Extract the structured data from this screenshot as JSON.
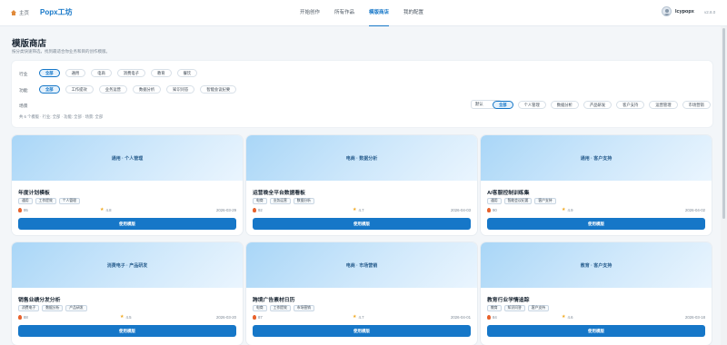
{
  "header": {
    "home_label": "主页",
    "brand": "Popx工坊",
    "nav": [
      "开始创作",
      "所有作品",
      "模版商店",
      "我的配置"
    ],
    "active_nav": "模版商店",
    "username": "lcypopx",
    "version": "v2.8.0"
  },
  "page": {
    "title": "模版商店",
    "subtitle": "按分类快速筛选，找到最适合你业务和目的创作模版。"
  },
  "filters": {
    "industry": {
      "label": "行业",
      "options": [
        "全部",
        "通用",
        "电商",
        "消费电子",
        "教育",
        "餐饮"
      ]
    },
    "function": {
      "label": "功能",
      "options": [
        "全部",
        "工作提效",
        "业务运营",
        "数据分析",
        "知识问答",
        "智能会议纪要"
      ]
    },
    "scene": {
      "label": "场景",
      "options": [
        "全部",
        "个人管理",
        "数据分析",
        "产品研发",
        "客户支持",
        "运营管理",
        "市场营销"
      ]
    },
    "sort": "默认",
    "summary": "共 6 个模版 · 行业: 全部 · 功能: 全部 · 场景: 全部"
  },
  "cards": [
    {
      "banner": "通用 · 个人管理",
      "title": "年度计划模板",
      "tags": [
        "通用",
        "工作提效",
        "个人管理"
      ],
      "uses": "95",
      "rating": "4.8",
      "date": "2026-03-29",
      "button": "使用模版"
    },
    {
      "banner": "电商 · 数据分析",
      "title": "运营晚全平台数据看板",
      "tags": [
        "电商",
        "业务运营",
        "数据分析"
      ],
      "uses": "92",
      "rating": "4.7",
      "date": "2026-04-03",
      "button": "使用模版"
    },
    {
      "banner": "通用 · 客户支持",
      "title": "AI客服控制训练集",
      "tags": [
        "通用",
        "智能会议纪要",
        "客户支持"
      ],
      "uses": "90",
      "rating": "4.9",
      "date": "2026-04-02",
      "button": "使用模版"
    },
    {
      "banner": "消费电子 · 产品研发",
      "title": "销售业绩分发分析",
      "tags": [
        "消费电子",
        "数据分析",
        "产品研发"
      ],
      "uses": "88",
      "rating": "4.5",
      "date": "2026-03-20",
      "button": "使用模版"
    },
    {
      "banner": "电商 · 市场营销",
      "title": "跨境广告素材日历",
      "tags": [
        "电商",
        "工作提效",
        "市场营销"
      ],
      "uses": "87",
      "rating": "4.7",
      "date": "2026-04-01",
      "button": "使用模版"
    },
    {
      "banner": "教育 · 客户支持",
      "title": "教育行业学情追踪",
      "tags": [
        "教育",
        "知识问答",
        "客户支持"
      ],
      "uses": "84",
      "rating": "4.6",
      "date": "2026-03-18",
      "button": "使用模版"
    }
  ],
  "colors": {
    "accent": "#1677c8",
    "background": "#f3f6f9",
    "banner_gradient": [
      "#a9d6f7",
      "#eaf5fe"
    ]
  }
}
